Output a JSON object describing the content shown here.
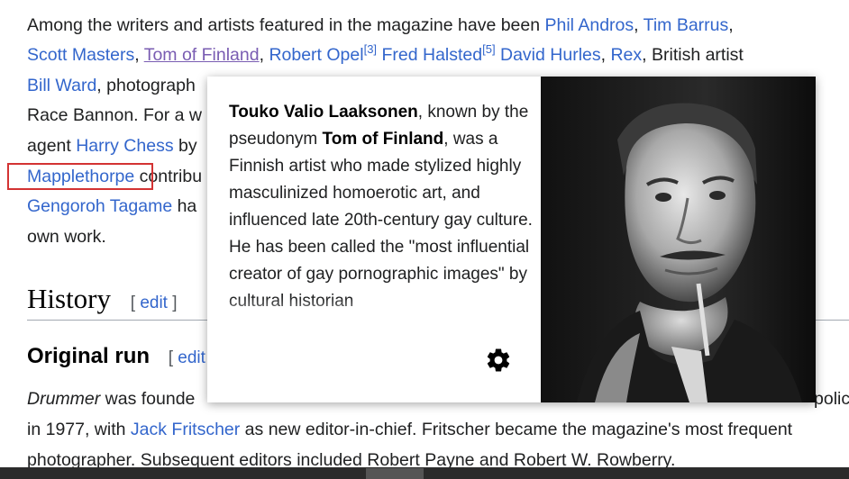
{
  "article": {
    "line1": {
      "text_a": "Among the writers and artists featured in the magazine have been ",
      "link_phil": "Phil Andros",
      "sep1": ", ",
      "link_tim": "Tim Barrus",
      "sep2": ","
    },
    "line2": {
      "link_scott": "Scott Masters",
      "sep1": ", ",
      "link_tom": "Tom of Finland",
      "sep2": ", ",
      "link_opel": "Robert Opel",
      "ref3": "[3]",
      "sep3": " ",
      "link_halsted": "Fred Halsted",
      "ref5": "[5]",
      "sep4": " ",
      "link_hurles": "David Hurles",
      "sep5": ", ",
      "link_rex": "Rex",
      "text_b": ", British artist"
    },
    "line3": {
      "link_ward": "Bill Ward",
      "text_b": ", photograph"
    },
    "line4": {
      "text_a": "Race Bannon. For a w"
    },
    "line5": {
      "text_a": "agent ",
      "link_harry": "Harry Chess",
      "text_b": " by"
    },
    "line6": {
      "link_mapple": "Mapplethorpe",
      "text_b": " contribu"
    },
    "line7": {
      "link_gengoroh": "Gengoroh Tagame",
      "text_b": " ha"
    },
    "line8": {
      "text_a": "own work."
    },
    "history": {
      "title": "History",
      "edit_open": "[ ",
      "edit": "edit",
      "edit_close": " ]"
    },
    "original_run": {
      "title": "Original run",
      "edit_open": "[ ",
      "edit": "edit"
    },
    "line9": {
      "text_italic": "Drummer",
      "text_a": " was founde",
      "text_tail": "polic"
    },
    "line10": {
      "text_a": "in 1977, with ",
      "link_jack": "Jack Fritscher",
      "text_b": " as new editor-in-chief. Fritscher became the magazine's most frequent"
    },
    "line11": {
      "text_a": "photographer. Subsequent editors included Robert Payne and Robert W. Rowberry."
    }
  },
  "popup": {
    "name_bold": "Touko Valio Laaksonen",
    "t1": ", known by the pseudonym ",
    "pseudonym_bold": "Tom of Finland",
    "t2": ", was a Finnish artist who made stylized highly masculinized homoerotic art, and influenced late 20th-century gay culture. He has been called the \"most influential creator of gay pornographic images\" by cultural historian",
    "settings_icon": "gear-icon"
  },
  "colors": {
    "link": "#3366cc",
    "visited": "#795cb2",
    "highlight": "#d33333"
  }
}
